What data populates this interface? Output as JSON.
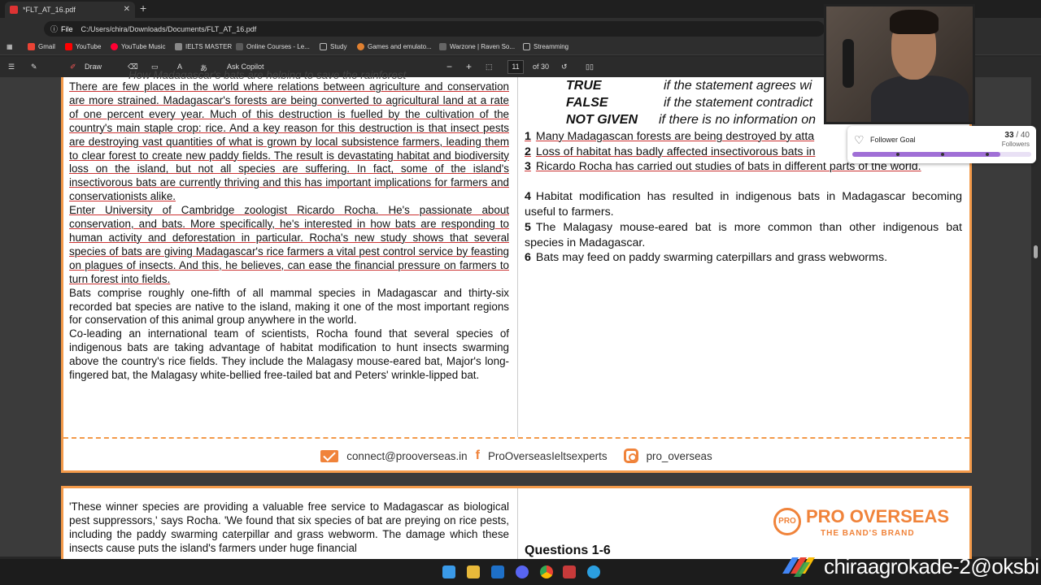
{
  "browser": {
    "tab_title": "*FLT_AT_16.pdf",
    "url_prefix": "File",
    "url": "C:/Users/chira/Downloads/Documents/FLT_AT_16.pdf",
    "bookmarks": [
      {
        "label": "Gmail",
        "color": "#ea4335"
      },
      {
        "label": "YouTube",
        "color": "#ff0000"
      },
      {
        "label": "YouTube Music",
        "color": "#ff0033"
      },
      {
        "label": "IELTS MASTER",
        "color": "#888888"
      },
      {
        "label": "Online Courses - Le...",
        "color": "#5a5a5a"
      },
      {
        "label": "Study",
        "color": "#777777"
      },
      {
        "label": "Games and emulato...",
        "color": "#e08030"
      },
      {
        "label": "Warzone | Raven So...",
        "color": "#666666"
      },
      {
        "label": "Streamming",
        "color": "#777777"
      }
    ]
  },
  "toolbar": {
    "draw": "Draw",
    "copilot": "Ask Copilot",
    "zoom_out": "−",
    "zoom_in": "+",
    "page_current": "11",
    "page_total": "of 30"
  },
  "page1": {
    "heading": "How Madagascar's bats are helping to save the rainforest",
    "paragraphs": [
      "There are few places in the world where relations between agriculture and conservation are more strained. Madagascar's forests are being converted to agricultural land at a rate of one percent every year. Much of this destruction is fuelled by the cultivation of the country's main staple crop: rice. And a key reason for this destruction is that insect pests are destroying vast quantities of what is grown by local subsistence farmers, leading them to clear forest to create new paddy fields. The result is devastating habitat and biodiversity loss on the island, but not all species are suffering. In fact, some of the island's insectivorous bats are currently thriving and this has important implications for farmers and conservationists alike.",
      "Enter University of Cambridge zoologist Ricardo Rocha. He's passionate about conservation, and bats. More specifically, he's interested in how bats are responding to human activity and deforestation in particular. Rocha's new study shows that several species of bats are giving Madagascar's rice farmers a vital pest control service by feasting on plagues of insects. And this, he believes, can ease the financial pressure on farmers to turn forest into fields.",
      "Bats comprise roughly one-fifth of all mammal species in Madagascar and thirty-six recorded bat species are native to the island, making it one of the most important regions for conservation of this animal group anywhere in the world.",
      "Co-leading an international team of scientists, Rocha found that several species of indigenous bats are taking advantage of habitat modification to hunt insects swarming above the country's rice fields. They include the Malagasy mouse-eared bat, Major's long-fingered bat, the Malagasy white-bellied free-tailed bat and Peters' wrinkle-lipped bat."
    ],
    "legend": [
      {
        "key": "TRUE",
        "text": "if the statement agrees wi"
      },
      {
        "key": "FALSE",
        "text": "if the statement contradict"
      },
      {
        "key": "NOT GIVEN",
        "text": "if there is no information on"
      }
    ],
    "questions": [
      {
        "n": "1",
        "text": "Many Madagascan forests are being destroyed by atta"
      },
      {
        "n": "2",
        "text": "Loss of habitat has badly affected insectivorous bats in"
      },
      {
        "n": "3",
        "text": "Ricardo Rocha has carried out studies of bats in different parts of the world."
      },
      {
        "n": "4",
        "text": "Habitat modification has resulted in indigenous bats in Madagascar becoming useful to farmers."
      },
      {
        "n": "5",
        "text": "The Malagasy mouse-eared bat is more common than other indigenous bat species in Madagascar."
      },
      {
        "n": "6",
        "text": "Bats may feed on paddy swarming caterpillars and grass webworms."
      }
    ],
    "footer": {
      "email": "connect@prooverseas.in",
      "facebook": "ProOverseasIeltsexperts",
      "instagram": "pro_overseas"
    }
  },
  "page2": {
    "paragraph": "'These winner species are providing a valuable free service to Madagascar as biological pest suppressors,' says Rocha. 'We found that six species of bat are preying on rice pests, including the paddy swarming caterpillar and grass webworm. The damage which these insects cause puts the island's farmers under huge financial",
    "brand_name": "PRO OVERSEAS",
    "brand_tag": "THE BAND'S BRAND",
    "seal": "PRO",
    "questions_heading": "Questions 1-6"
  },
  "overlay": {
    "goal_label": "Follower Goal",
    "goal_current": "33",
    "goal_total": "/ 40",
    "goal_unit": "Followers",
    "goal_progress": 0.825,
    "upi": "chiraagrokade-2@oksbi"
  }
}
